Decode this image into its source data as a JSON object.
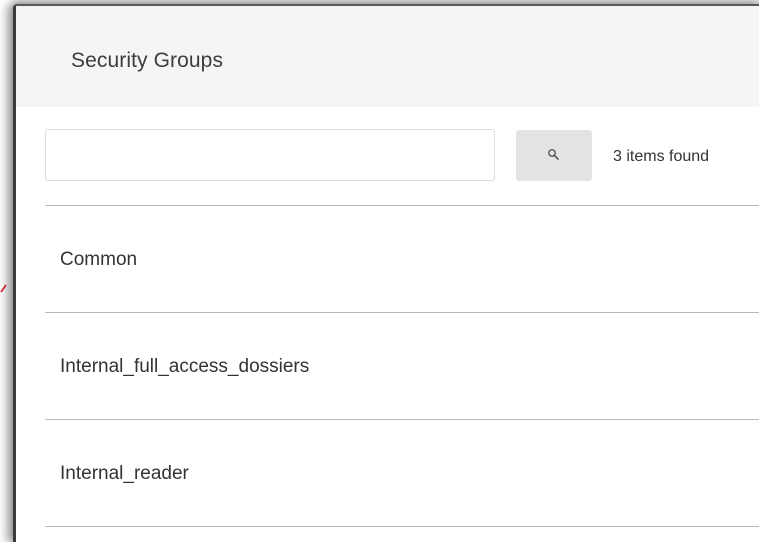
{
  "panel": {
    "title": "Security Groups"
  },
  "search": {
    "value": "",
    "placeholder": "",
    "button_icon": "search-icon",
    "result_count": "3 items found"
  },
  "groups": [
    {
      "label": "Common"
    },
    {
      "label": "Internal_full_access_dossiers"
    },
    {
      "label": "Internal_reader"
    }
  ],
  "colors": {
    "header_background": "#f5f5f5",
    "search_button_background": "#e3e3e3",
    "divider": "#b8b8b8",
    "text": "#333333",
    "annotation_accent": "#e0202a"
  }
}
